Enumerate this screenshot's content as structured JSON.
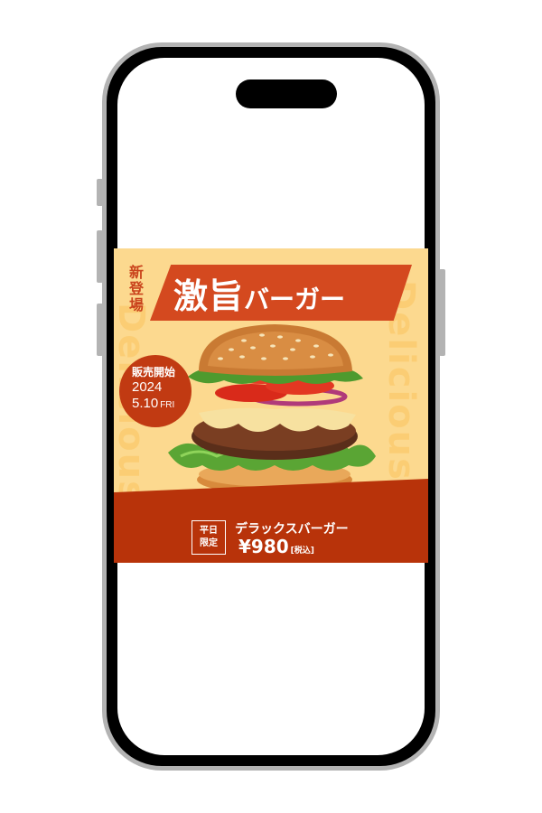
{
  "banner": {
    "new_label": "新登場",
    "title_main": "激旨",
    "title_sub": "バーガー",
    "bg_text": "Delicious burg",
    "sale_label": "販売開始",
    "sale_year": "2024",
    "sale_date": "5.10",
    "sale_day": "FRI",
    "limited_line1": "平日",
    "limited_line2": "限定",
    "product_name": "デラックスバーガー",
    "price": "¥980",
    "tax_note": "[税込]"
  },
  "colors": {
    "background": "#fcd98f",
    "accent": "#d4491f",
    "band": "#b8330a"
  },
  "icons": [
    "burger-photo"
  ]
}
